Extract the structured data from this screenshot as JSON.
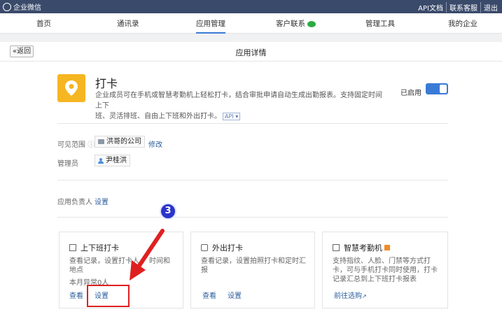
{
  "topbar": {
    "brand": "企业微信",
    "links": [
      "API文档",
      "联系客服",
      "退出"
    ]
  },
  "nav": {
    "items": [
      "首页",
      "通讯录",
      "应用管理",
      "客户联系",
      "管理工具",
      "我的企业"
    ],
    "active": "应用管理"
  },
  "subheader": {
    "back_label": "«返回",
    "title": "应用详情"
  },
  "app": {
    "icon": "location-pin-icon",
    "icon_color": "#f5b622",
    "name": "打卡",
    "desc_line1": "企业成员可在手机或智慧考勤机上轻松打卡，结合审批申请自动生成出勤报表。支持固定时间上下",
    "desc_line2": "班、灵活排班、自由上下班和外出打卡。",
    "api_tag": "API",
    "status_label": "已启用",
    "enabled": true,
    "accent_color": "#3a7bd5"
  },
  "visibility": {
    "label": "可见范围",
    "scope": "洪哥的公司",
    "edit_label": "修改"
  },
  "admin": {
    "label": "管理员",
    "name": "尹桂洪"
  },
  "owner": {
    "label": "应用负责人",
    "set_label": "设置"
  },
  "cards": [
    {
      "title": "上下班打卡",
      "desc_line1": "查看记录，设置打卡人",
      "desc_line1_tail": "时间和",
      "desc_line2": "地点",
      "count": "本月异常0人",
      "view_label": "查看",
      "set_label": "设置"
    },
    {
      "title": "外出打卡",
      "desc_line1": "查看记录，设置拍照打卡和定时汇",
      "desc_line2": "报",
      "view_label": "查看",
      "set_label": "设置"
    },
    {
      "title": "智慧考勤机",
      "desc_line1": "支持指纹、人脸、门禁等方式打",
      "desc_line2": "卡，可与手机打卡同时使用，打卡",
      "desc_line3": "记录汇总到上下班打卡报表",
      "link_label": "前往选购"
    }
  ],
  "annotation": {
    "step": "3"
  }
}
